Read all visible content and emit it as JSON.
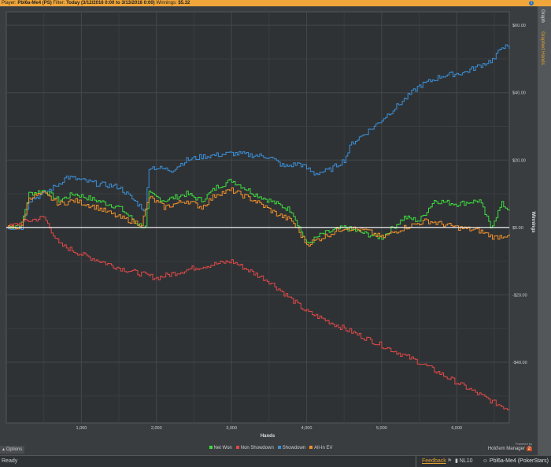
{
  "topbar": {
    "player_label": "Player:",
    "player": "Pbl6a-Me4 (PS)",
    "filter_label": "Filter:",
    "filter": "Today (3/12/2016 0:00 to 3/13/2016 0:00)",
    "winnings_label": "Winnings:",
    "winnings": "$5.32"
  },
  "sidebar": {
    "tabs": [
      "Graph",
      "Graphed Hands"
    ]
  },
  "options_label": "Options",
  "brand": {
    "powered": "Powered by",
    "name": "Hold'em Manager",
    "version": "2"
  },
  "status": {
    "text": "Ready",
    "feedback": "Feedback",
    "limit": "NL10",
    "account": "Pbl6a-Me4 (PokerStars)"
  },
  "colors": {
    "net_won": "#3ddc3d",
    "non_showdown": "#e04848",
    "showdown": "#3a8fd8",
    "all_in_ev": "#f0902a",
    "accent": "#f0a63a"
  },
  "chart_data": {
    "type": "line",
    "xlabel": "Hands",
    "ylabel": "Winnings",
    "xlim": [
      0,
      6700
    ],
    "ylim": [
      -58,
      64
    ],
    "xticks": [
      1000,
      2000,
      3000,
      4000,
      5000,
      6000
    ],
    "xtick_labels": [
      "1,000",
      "2,000",
      "3,000",
      "4,000",
      "5,000",
      "6,000"
    ],
    "yticks": [
      60,
      40,
      20,
      0,
      -20,
      -40
    ],
    "ytick_labels": [
      "$60.00",
      "$40.00",
      "$20.00",
      "$0.00",
      "-$20.00",
      "-$40.00"
    ],
    "legend_position": "bottom",
    "series": [
      {
        "name": "Net Won",
        "color": "#3ddc3d",
        "points": [
          [
            0,
            0
          ],
          [
            200,
            1
          ],
          [
            300,
            10
          ],
          [
            500,
            11
          ],
          [
            700,
            8
          ],
          [
            900,
            10
          ],
          [
            1200,
            8
          ],
          [
            1500,
            6
          ],
          [
            1750,
            1
          ],
          [
            1850,
            0
          ],
          [
            1900,
            10
          ],
          [
            2100,
            8
          ],
          [
            2400,
            10
          ],
          [
            2600,
            8
          ],
          [
            2800,
            12
          ],
          [
            3000,
            14
          ],
          [
            3300,
            10
          ],
          [
            3600,
            7
          ],
          [
            3800,
            5
          ],
          [
            3900,
            0
          ],
          [
            4000,
            -5
          ],
          [
            4200,
            -2
          ],
          [
            4500,
            0
          ],
          [
            4800,
            -2
          ],
          [
            5000,
            -3
          ],
          [
            5300,
            3
          ],
          [
            5500,
            2
          ],
          [
            5700,
            8
          ],
          [
            6000,
            7
          ],
          [
            6300,
            8
          ],
          [
            6450,
            0
          ],
          [
            6600,
            7
          ],
          [
            6700,
            5
          ]
        ]
      },
      {
        "name": "Non Showdown",
        "color": "#e04848",
        "points": [
          [
            0,
            0
          ],
          [
            300,
            2
          ],
          [
            500,
            3
          ],
          [
            700,
            -5
          ],
          [
            1000,
            -8
          ],
          [
            1500,
            -12
          ],
          [
            2000,
            -15
          ],
          [
            2500,
            -12
          ],
          [
            3000,
            -10
          ],
          [
            3500,
            -16
          ],
          [
            4000,
            -25
          ],
          [
            4500,
            -30
          ],
          [
            5000,
            -35
          ],
          [
            5500,
            -40
          ],
          [
            6000,
            -46
          ],
          [
            6500,
            -52
          ],
          [
            6700,
            -54
          ]
        ]
      },
      {
        "name": "Showdown",
        "color": "#3a8fd8",
        "points": [
          [
            0,
            0
          ],
          [
            200,
            0
          ],
          [
            300,
            8
          ],
          [
            500,
            10
          ],
          [
            700,
            13
          ],
          [
            800,
            15
          ],
          [
            1000,
            14
          ],
          [
            1200,
            13
          ],
          [
            1500,
            12
          ],
          [
            1700,
            8
          ],
          [
            1850,
            5
          ],
          [
            1900,
            18
          ],
          [
            2200,
            17
          ],
          [
            2400,
            20
          ],
          [
            2600,
            21
          ],
          [
            3000,
            22
          ],
          [
            3500,
            21
          ],
          [
            3700,
            18
          ],
          [
            3900,
            19
          ],
          [
            4100,
            16
          ],
          [
            4300,
            17
          ],
          [
            4500,
            20
          ],
          [
            4600,
            25
          ],
          [
            4900,
            30
          ],
          [
            5200,
            36
          ],
          [
            5500,
            42
          ],
          [
            5800,
            45
          ],
          [
            6100,
            46
          ],
          [
            6300,
            48
          ],
          [
            6500,
            50
          ],
          [
            6600,
            54
          ],
          [
            6700,
            53
          ]
        ]
      },
      {
        "name": "All-In EV",
        "color": "#f0902a",
        "points": [
          [
            0,
            0
          ],
          [
            200,
            0
          ],
          [
            300,
            9
          ],
          [
            500,
            10
          ],
          [
            700,
            7
          ],
          [
            900,
            8
          ],
          [
            1200,
            6
          ],
          [
            1500,
            3
          ],
          [
            1800,
            1
          ],
          [
            1900,
            9
          ],
          [
            2100,
            6
          ],
          [
            2400,
            8
          ],
          [
            2600,
            6
          ],
          [
            2800,
            10
          ],
          [
            3000,
            11
          ],
          [
            3300,
            8
          ],
          [
            3600,
            4
          ],
          [
            3800,
            2
          ],
          [
            4000,
            -5
          ],
          [
            4200,
            -3
          ],
          [
            4500,
            0
          ],
          [
            4800,
            -1
          ],
          [
            5000,
            -3
          ],
          [
            5300,
            0
          ],
          [
            5600,
            2
          ],
          [
            6000,
            0
          ],
          [
            6300,
            -1
          ],
          [
            6500,
            -3
          ],
          [
            6700,
            -2
          ]
        ]
      }
    ]
  }
}
